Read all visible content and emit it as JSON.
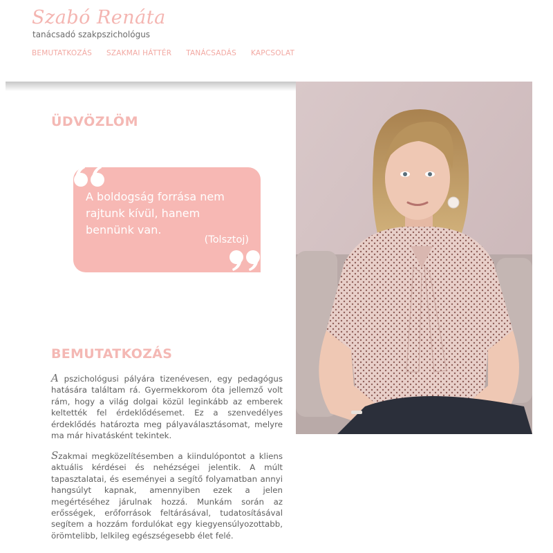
{
  "header": {
    "brand_name": "Szabó Renáta",
    "tagline": "tanácsadó szakpszichológus",
    "nav": [
      {
        "label": "BEMUTATKOZÁS"
      },
      {
        "label": "SZAKMAI HÁTTÉR"
      },
      {
        "label": "TANÁCSADÁS"
      },
      {
        "label": "KAPCSOLAT"
      }
    ]
  },
  "welcome": {
    "heading": "ÜDVÖZLÖM",
    "quote_text": "A boldogság forrása nem rajtunk kívül, hanem bennünk van.",
    "quote_author": "(Tolsztoj)"
  },
  "intro": {
    "heading": "BEMUTATKOZÁS",
    "p1_dropcap": "A",
    "p1_text": " pszichológusi pályára tizenévesen, egy pedagógus hatására találtam rá. Gyermekkorom óta jellemző volt rám, hogy a világ dolgai közül leginkább az emberek keltették fel érdeklődésemet. Ez a szenvedélyes érdeklődés határozta meg pályaválasztásomat, melyre ma már hivatásként tekintek.",
    "p2_dropcap": "S",
    "p2_text": "zakmai megközelítésemben a kiindulópontot a kliens aktuális kérdései és nehézségei jelentik. A múlt tapasztalatai, és eseményei a segítő folyamatban annyi hangsúlyt kapnak, amennyiben ezek a jelen megértéséhez járulnak hozzá. Munkám során az erősségek, erőforrások feltárásával, tudatosításával segítem a hozzám fordulókat egy kiegyensúlyozottabb, örömtelibb, lelkileg egészségesebb élet felé."
  },
  "colors": {
    "accent": "#f4b5b1",
    "quote_bg": "#f7b8b4",
    "body_text": "#5e5e5e"
  },
  "icons": {
    "quote_open": "open-quote-icon",
    "quote_close": "close-quote-icon"
  }
}
